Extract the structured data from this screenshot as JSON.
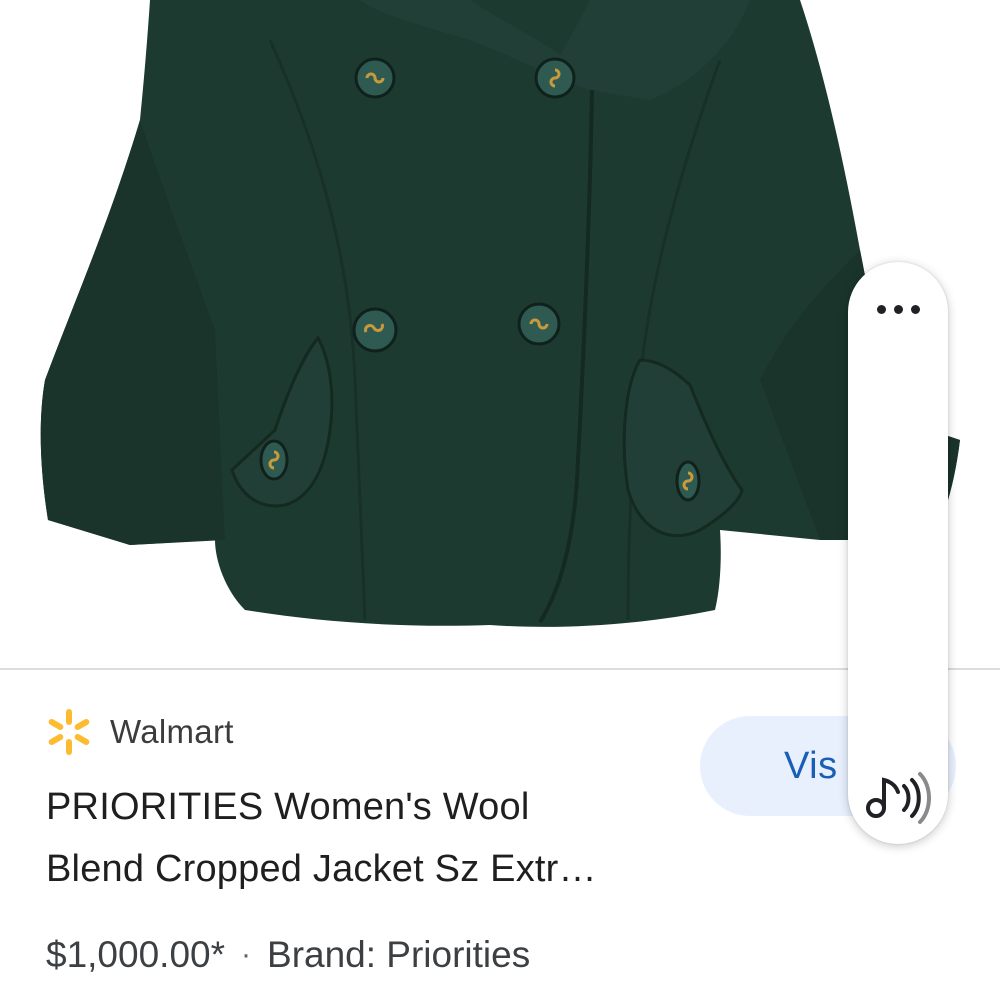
{
  "product_image": {
    "alt": "Dark green wool blend cropped jacket",
    "jacket_color": "#1d3a31",
    "button_color": "#2f5a52",
    "button_thread_color": "#c79a3c"
  },
  "merchant": {
    "name": "Walmart",
    "logo_icon": "walmart-spark-icon",
    "logo_color": "#fdbb30"
  },
  "product": {
    "title_line_1": "PRIORITIES Women's Wool",
    "title_line_2": "Blend Cropped Jacket Sz Extr…",
    "price": "$1,000.00*",
    "separator": "·",
    "brand": "Brand: Priorities"
  },
  "actions": {
    "visit_label": "Vis",
    "visit_bg": "#e8f0fe",
    "visit_color": "#1a5fb4"
  },
  "floating_panel": {
    "more_icon": "more-horizontal-icon",
    "audio_icon": "read-aloud-icon"
  }
}
